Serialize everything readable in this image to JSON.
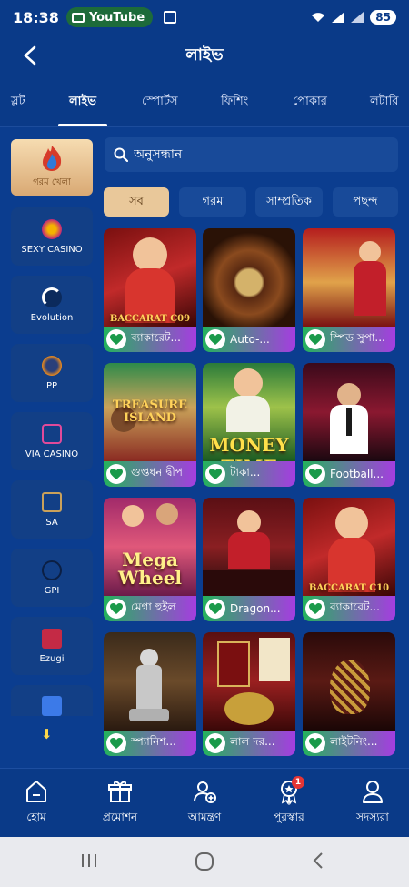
{
  "status_bar": {
    "time": "18:38",
    "app_pill": "YouTube",
    "battery": "85"
  },
  "header": {
    "title": "লাইভ"
  },
  "tabs": [
    {
      "label": "স্লট"
    },
    {
      "label": "লাইভ"
    },
    {
      "label": "স্পোর্টস"
    },
    {
      "label": "ফিশিং"
    },
    {
      "label": "পোকার"
    },
    {
      "label": "লটারি"
    }
  ],
  "providers": [
    {
      "label": "গরম খেলা",
      "icon": "flame-icon"
    },
    {
      "label": "SEXY CASINO",
      "icon": "sexy-casino-logo"
    },
    {
      "label": "Evolution",
      "icon": "evolution-logo"
    },
    {
      "label": "PP",
      "icon": "pragmatic-play-logo"
    },
    {
      "label": "VIA CASINO",
      "icon": "via-casino-logo"
    },
    {
      "label": "SA",
      "icon": "sa-gaming-logo"
    },
    {
      "label": "GPI",
      "icon": "gpi-logo"
    },
    {
      "label": "Ezugi",
      "icon": "ezugi-logo"
    },
    {
      "label": "",
      "icon": "ai-logo"
    }
  ],
  "search": {
    "placeholder": "অনুসন্ধান"
  },
  "filters": [
    {
      "label": "সব"
    },
    {
      "label": "গরম"
    },
    {
      "label": "সাম্প্রতিক"
    },
    {
      "label": "পছন্দ"
    }
  ],
  "games": [
    {
      "name": "ব্যাকারেট...",
      "overlay": "BACCARAT C09"
    },
    {
      "name": "Auto-...",
      "overlay": ""
    },
    {
      "name": "স্পিড সুপা...",
      "overlay": ""
    },
    {
      "name": "গুপ্তধন দ্বীপ",
      "overlay": "TREASURE ISLAND"
    },
    {
      "name": "টাকা...",
      "overlay": "MONEY TIME"
    },
    {
      "name": "Football...",
      "overlay": ""
    },
    {
      "name": "মেগা হুইল",
      "overlay": "Mega Wheel"
    },
    {
      "name": "Dragon...",
      "overlay": ""
    },
    {
      "name": "ব্যাকারেট...",
      "overlay": "BACCARAT C10"
    },
    {
      "name": "স্প্যানিশ...",
      "overlay": ""
    },
    {
      "name": "লাল দর...",
      "overlay": ""
    },
    {
      "name": "লাইটনিং...",
      "overlay": ""
    }
  ],
  "bottom_nav": [
    {
      "label": "হোম",
      "icon": "home-icon"
    },
    {
      "label": "প্রমোশন",
      "icon": "gift-icon"
    },
    {
      "label": "আমন্ত্রণ",
      "icon": "invite-user-icon"
    },
    {
      "label": "পুরস্কার",
      "icon": "reward-medal-icon",
      "badge": "1"
    },
    {
      "label": "সদস্যরা",
      "icon": "member-icon"
    }
  ]
}
